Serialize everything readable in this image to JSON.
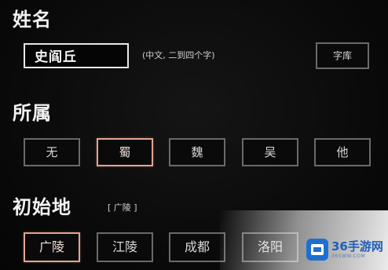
{
  "name_section": {
    "title": "姓名",
    "input_value": "史阎丘",
    "hint": "(中文, 二到四个字)",
    "library_button": "字库"
  },
  "faction_section": {
    "title": "所属",
    "options": [
      "无",
      "蜀",
      "魏",
      "吴",
      "他"
    ],
    "selected": "蜀"
  },
  "origin_section": {
    "title": "初始地",
    "current_tag": "[ 广陵 ]",
    "options": [
      "广陵",
      "江陵",
      "成都",
      "洛阳"
    ],
    "selected": "广陵"
  },
  "watermark": {
    "main": "36手游网",
    "sub": "36SWW.COM"
  },
  "colors": {
    "background": "#0b0b0b",
    "selected_border": "#e2a592",
    "normal_border": "#6a6a6a",
    "watermark_blue": "#1f6fd1"
  }
}
